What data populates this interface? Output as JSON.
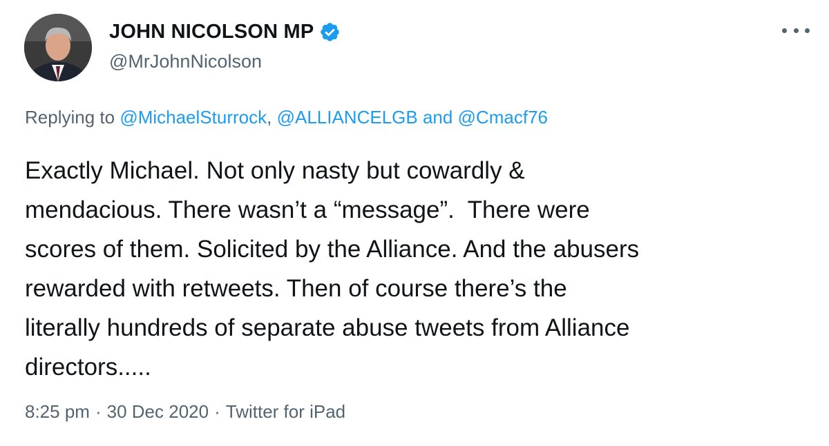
{
  "author": {
    "display_name": "JOHN NICOLSON MP",
    "handle": "@MrJohnNicolson",
    "verified_icon": "verified-badge-icon"
  },
  "reply_context": {
    "prefix": "Replying to",
    "mention1": "@MichaelSturrock",
    "comma": ",",
    "mention2": "@ALLIANCELGB",
    "conjunction": "and",
    "mention3": "@Cmacf76"
  },
  "tweet": {
    "lines": [
      "Exactly Michael. Not only nasty but cowardly &",
      "mendacious. There wasn’t a “message”.  There were",
      "scores of them. Solicited by the Alliance. And the abusers",
      "rewarded with retweets. Then of course there’s the",
      "literally hundreds of separate abuse tweets from Alliance",
      "directors....."
    ]
  },
  "meta": {
    "time": "8:25 pm",
    "separator": "·",
    "date": "30 Dec 2020",
    "source": "Twitter for iPad"
  },
  "colors": {
    "accent": "#1d9bf0",
    "secondary_text": "#536471",
    "primary_text": "#0f1419"
  }
}
